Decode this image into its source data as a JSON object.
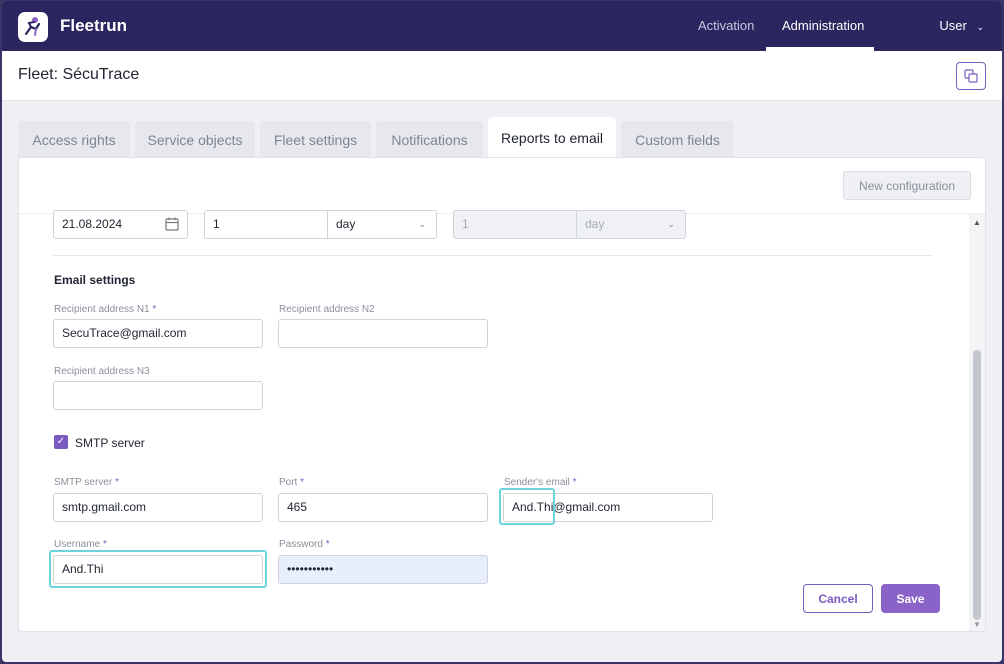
{
  "app": {
    "name": "Fleetrun"
  },
  "nav": {
    "activation": "Activation",
    "administration": "Administration",
    "user": "User"
  },
  "page": {
    "title": "Fleet: SécuTrace"
  },
  "tabs": [
    {
      "label": "Access rights"
    },
    {
      "label": "Service objects"
    },
    {
      "label": "Fleet settings"
    },
    {
      "label": "Notifications"
    },
    {
      "label": "Reports to email"
    },
    {
      "label": "Custom fields"
    }
  ],
  "toolbar": {
    "new_configuration": "New configuration"
  },
  "schedule": {
    "date": "21.08.2024",
    "interval_value": "1",
    "interval_unit": "day",
    "disabled_value": "1",
    "disabled_unit": "day"
  },
  "email_settings": {
    "title": "Email settings",
    "recipient1_label": "Recipient address N1",
    "recipient1_value": "SecuTrace@gmail.com",
    "recipient2_label": "Recipient address N2",
    "recipient2_value": "",
    "recipient3_label": "Recipient address N3",
    "recipient3_value": ""
  },
  "smtp": {
    "checkbox_label": "SMTP server",
    "server_label": "SMTP server",
    "server_value": "smtp.gmail.com",
    "port_label": "Port",
    "port_value": "465",
    "sender_label": "Sender's email",
    "sender_value": "And.Thi@gmail.com",
    "username_label": "Username",
    "username_value": "And.Thi",
    "password_label": "Password",
    "password_value": "•••••••••••"
  },
  "actions": {
    "cancel": "Cancel",
    "save": "Save"
  },
  "required_marker": "*",
  "colors": {
    "nav_bg": "#2c2660",
    "accent": "#7a5cc0",
    "focus": "#6bd4dd"
  }
}
